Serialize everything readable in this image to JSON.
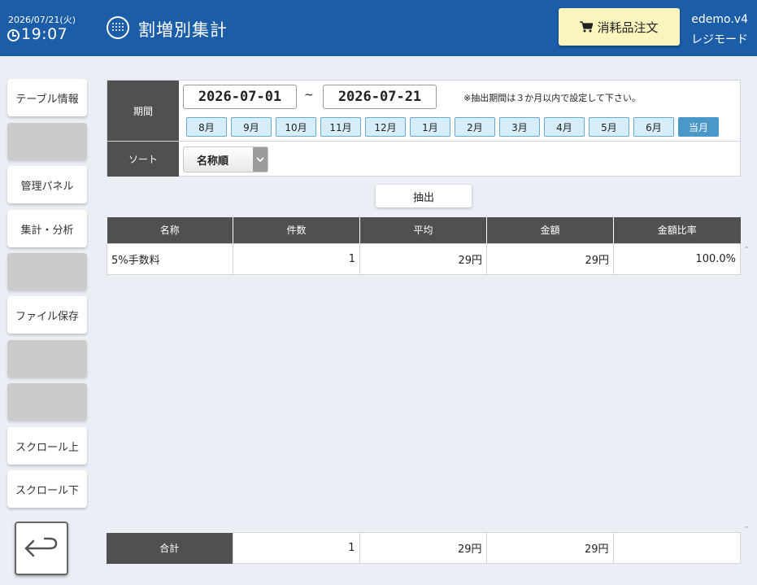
{
  "header": {
    "date": "2026/07/21(火)",
    "time": "19:07",
    "title": "割増別集計",
    "order_button": "消耗品注文",
    "user": "edemo.v4",
    "mode": "レジモード"
  },
  "sidebar": {
    "items": [
      {
        "label": "テーブル情報",
        "enabled": true
      },
      {
        "label": "",
        "enabled": false
      },
      {
        "label": "管理パネル",
        "enabled": true
      },
      {
        "label": "集計・分析",
        "enabled": true
      },
      {
        "label": "",
        "enabled": false
      },
      {
        "label": "ファイル保存",
        "enabled": true
      },
      {
        "label": "",
        "enabled": false
      },
      {
        "label": "",
        "enabled": false
      },
      {
        "label": "スクロール上",
        "enabled": true
      },
      {
        "label": "スクロール下",
        "enabled": true
      }
    ]
  },
  "filter": {
    "period_label": "期間",
    "date_from": "2026-07-01",
    "separator": "~",
    "date_to": "2026-07-21",
    "note": "※抽出期間は３か月以内で設定して下さい。",
    "months": [
      "8月",
      "9月",
      "10月",
      "11月",
      "12月",
      "1月",
      "2月",
      "3月",
      "4月",
      "5月",
      "6月",
      "当月"
    ],
    "active_month": "当月",
    "sort_label": "ソート",
    "sort_value": "名称順"
  },
  "extract_button": "抽出",
  "table": {
    "columns": [
      "名称",
      "件数",
      "平均",
      "金額",
      "金額比率"
    ],
    "rows": [
      [
        "5%手数料",
        "1",
        "29円",
        "29円",
        "100.0%"
      ]
    ]
  },
  "totals": {
    "label": "合計",
    "count": "1",
    "average": "29円",
    "amount": "29円",
    "ratio": ""
  },
  "colors": {
    "header_bg": "#1c5da8",
    "order_button_bg": "#fbf5bd",
    "month_button_bg": "#d6eef9",
    "month_active_bg": "#4a98c8",
    "label_bg": "#505050"
  }
}
